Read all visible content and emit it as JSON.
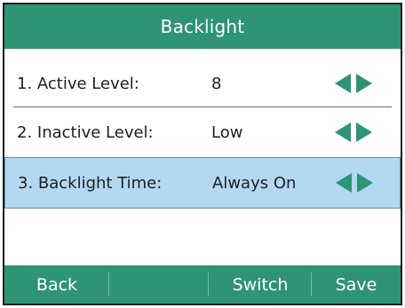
{
  "header": {
    "title": "Backlight"
  },
  "rows": [
    {
      "label": "1. Active Level:",
      "value": "8",
      "selected": false
    },
    {
      "label": "2. Inactive Level:",
      "value": "Low",
      "selected": false
    },
    {
      "label": "3. Backlight Time:",
      "value": "Always On",
      "selected": true
    }
  ],
  "icons": {
    "left_arrow": "left-arrow-icon",
    "right_arrow": "right-arrow-icon",
    "arrow_color": "#2e9475"
  },
  "colors": {
    "accent": "#2e9475",
    "selected_bg": "#b3d8f2"
  },
  "softkeys": [
    {
      "label": "Back"
    },
    {
      "label": ""
    },
    {
      "label": "Switch"
    },
    {
      "label": "Save"
    }
  ]
}
